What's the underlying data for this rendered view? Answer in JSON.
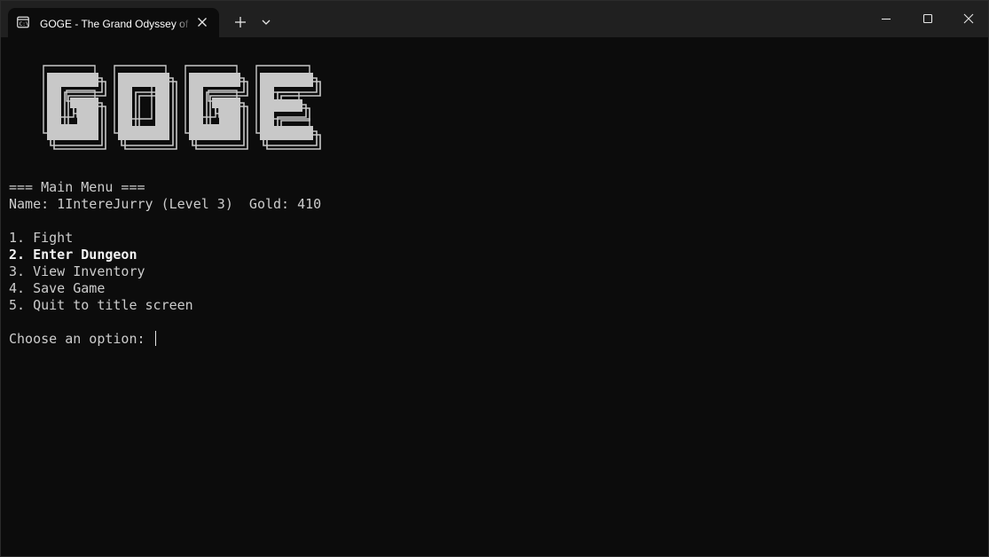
{
  "window": {
    "tab_title": "GOGE - The Grand Odyssey of",
    "tab_icon": "terminal-icon",
    "controls": [
      "minimize-icon",
      "maximize-icon",
      "close-icon"
    ]
  },
  "terminal": {
    "banner_text": "GOGE",
    "menu_header": "=== Main Menu ===",
    "player_info": "Name: 1IntereJurry (Level 3)  Gold: 410",
    "options": [
      "1. Fight",
      "2. Enter Dungeon",
      "3. View Inventory",
      "4. Save Game",
      "5. Quit to title screen"
    ],
    "prompt": "Choose an option: "
  },
  "colors": {
    "background": "#0c0c0c",
    "titlebar": "#202020",
    "text": "#cccccc",
    "banner": "#c8c8c8"
  }
}
